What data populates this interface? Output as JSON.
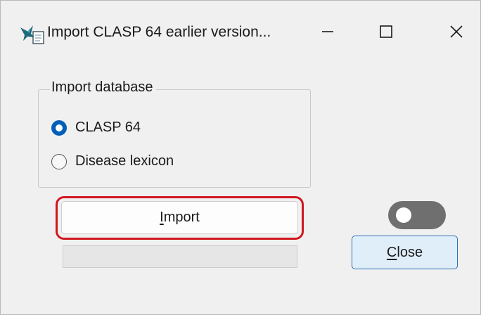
{
  "window": {
    "title": "Import CLASP 64 earlier version...",
    "controls": {
      "minimize_icon": "minimize-icon",
      "maximize_icon": "maximize-icon",
      "close_icon": "close-icon"
    }
  },
  "group": {
    "legend": "Import database",
    "options": [
      {
        "label": "CLASP 64",
        "checked": true
      },
      {
        "label": "Disease lexicon",
        "checked": false
      }
    ]
  },
  "buttons": {
    "import": {
      "mnemonic": "I",
      "rest": "mport"
    },
    "close": {
      "mnemonic": "C",
      "rest": "lose"
    }
  },
  "progress": {
    "value": 0
  },
  "toggle": {
    "on": false
  },
  "colors": {
    "accent": "#005fb8",
    "highlight": "#d1161e",
    "toggle_off": "#6f6f6f",
    "close_btn_bg": "#e0eef9",
    "close_btn_border": "#2c6fb7"
  }
}
